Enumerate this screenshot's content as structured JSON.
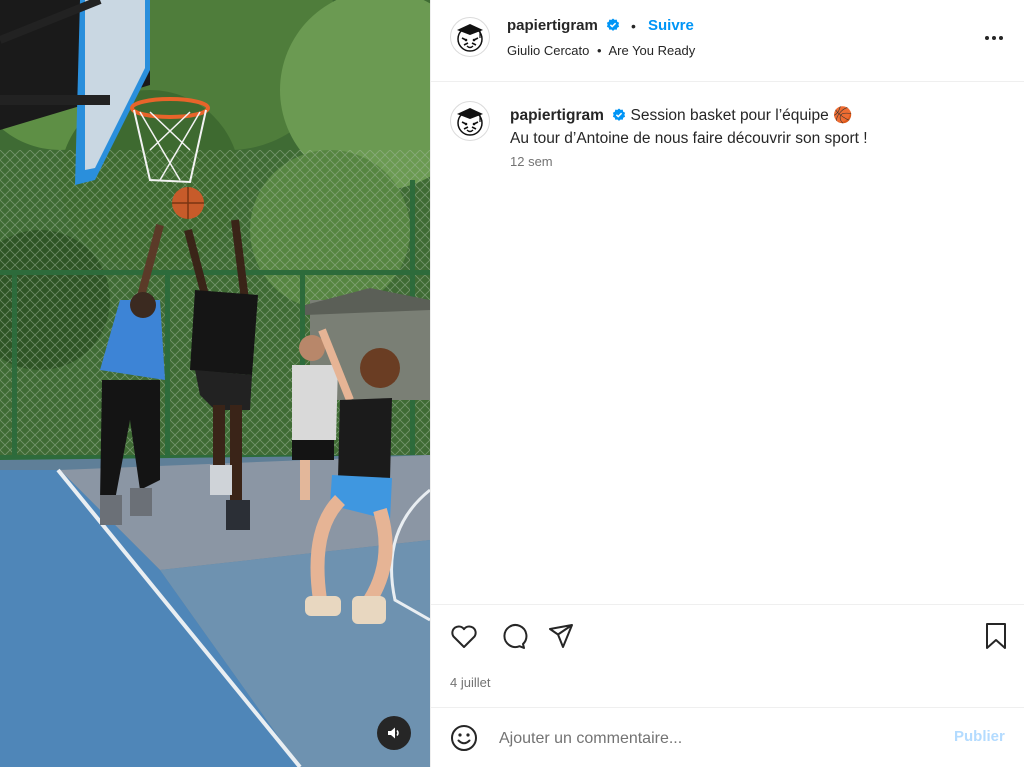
{
  "account": {
    "username": "papiertigram",
    "verified": true,
    "follow_label": "Suivre",
    "separator": "•"
  },
  "header": {
    "audio_artist": "Giulio Cercato",
    "audio_separator": "•",
    "audio_track": "Are You Ready"
  },
  "caption": {
    "username": "papiertigram",
    "line1": "Session basket pour l’équipe",
    "emoji": "🏀",
    "line2": "Au tour d’Antoine de nous faire découvrir son sport !",
    "time_ago": "12 sem"
  },
  "post": {
    "date": "4 juillet"
  },
  "comment_box": {
    "placeholder": "Ajouter un commentaire...",
    "publish_label": "Publier"
  },
  "icons": {
    "verified": "verified-badge-icon",
    "more": "more-options-icon",
    "like": "heart-icon",
    "comment": "comment-icon",
    "share": "share-icon",
    "save": "bookmark-icon",
    "emoji": "emoji-icon",
    "audio": "speaker-icon"
  },
  "colors": {
    "link": "#0095f6",
    "verified": "#0095f6",
    "publish_disabled": "#b3dbff",
    "muted_text": "#737373"
  }
}
